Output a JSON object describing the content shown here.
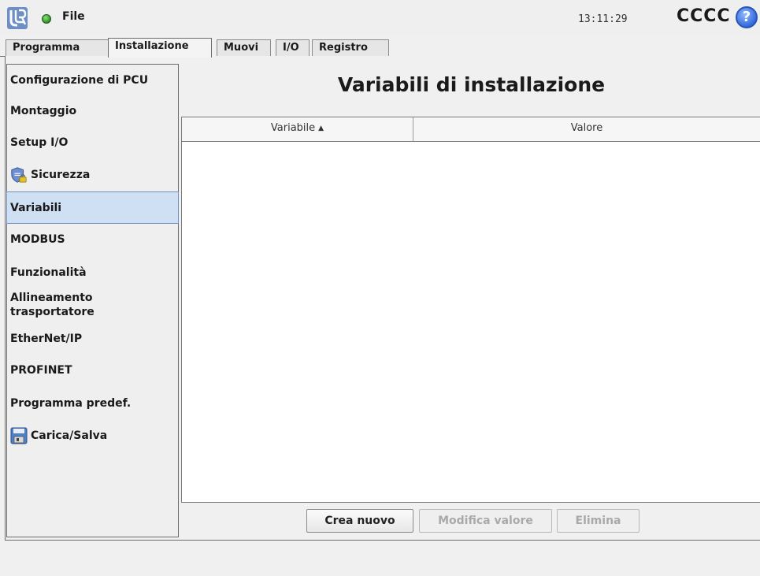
{
  "header": {
    "logo_icon": "universal-robots-logo",
    "status_color": "#3a9b2e",
    "file_menu_label": "File",
    "clock": "13:11:29",
    "robot_name": "CCCC",
    "help_label": "?"
  },
  "tabs": [
    {
      "label": "Programma",
      "active": false
    },
    {
      "label": "Installazione",
      "active": true
    },
    {
      "label": "Muovi",
      "active": false
    },
    {
      "label": "I/O",
      "active": false
    },
    {
      "label": "Registro",
      "active": false
    }
  ],
  "sidebar": {
    "items": [
      {
        "label": "Configurazione di PCU"
      },
      {
        "label": "Montaggio"
      },
      {
        "label": "Setup I/O"
      },
      {
        "label": "Sicurezza",
        "icon": "shield-lock-icon"
      },
      {
        "label": "Variabili",
        "active": true
      },
      {
        "label": "MODBUS"
      },
      {
        "label": "Funzionalità"
      },
      {
        "label": "Allineamento trasportatore"
      },
      {
        "label": "EtherNet/IP"
      },
      {
        "label": "PROFINET"
      },
      {
        "label": "Programma predef."
      },
      {
        "label": "Carica/Salva",
        "icon": "floppy-disk-icon"
      }
    ]
  },
  "main": {
    "title": "Variabili di installazione",
    "table": {
      "columns": [
        "Variabile",
        "Valore"
      ],
      "sort_indicator": "▲",
      "rows": []
    },
    "buttons": {
      "create": "Crea nuovo",
      "edit": "Modifica valore",
      "delete": "Elimina"
    }
  },
  "colors": {
    "accent_selected": "#cfe0f5",
    "help_blue": "#2f66d8",
    "disabled_text": "#a9a9a9"
  }
}
